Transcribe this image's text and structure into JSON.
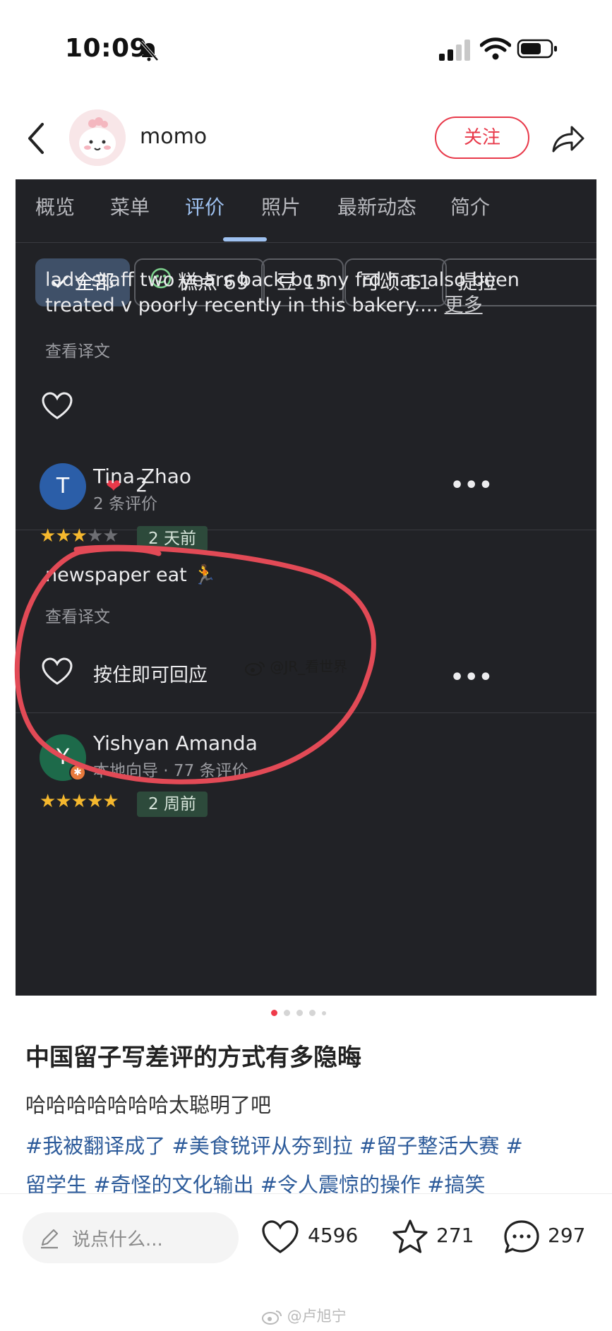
{
  "status_bar": {
    "time": "10:09"
  },
  "header": {
    "author": "momo",
    "follow_label": "关注"
  },
  "screenshot": {
    "tabs": [
      {
        "label": "概览"
      },
      {
        "label": "菜单"
      },
      {
        "label": "评价",
        "active": true
      },
      {
        "label": "照片"
      },
      {
        "label": "最新动态"
      },
      {
        "label": "简介"
      }
    ],
    "filters": [
      {
        "label": "全部",
        "selected": true
      },
      {
        "label": "糕点 69"
      },
      {
        "label": "豆 15"
      },
      {
        "label": "可颂 11"
      },
      {
        "label": "提拉"
      }
    ],
    "review1": {
      "line1": "lady staff two years back bc my frd has also been",
      "line2": "treated v poorly recently in this bakery....",
      "more": "更多",
      "translate": "查看译文",
      "reaction_count": "2"
    },
    "review2": {
      "initial": "T",
      "name": "Tina Zhao",
      "meta": "2 条评价",
      "rating": 3,
      "date": "2 天前",
      "text": "newspaper eat",
      "translate": "查看译文",
      "reply_hint": "按住即可回应"
    },
    "review3": {
      "initial": "Y",
      "name": "Yishyan Amanda",
      "meta": "本地向导 · 77 条评价",
      "rating": 5,
      "date": "2 周前"
    },
    "watermark": "@JR_看世界"
  },
  "post": {
    "title": "中国留子写差评的方式有多隐晦",
    "body": "哈哈哈哈哈哈哈太聪明了吧",
    "tags_line1": "#我被翻译成了 #美食锐评从夯到拉 #留子整活大赛 #",
    "tags_line2": "留学生 #奇怪的文化输出 #令人震惊的操作 #搞笑"
  },
  "bottom_bar": {
    "placeholder": "说点什么...",
    "likes": "4596",
    "collects": "271",
    "comments": "297"
  },
  "footer_watermark": "@卢旭宁",
  "colors": {
    "accent": "#e8394a",
    "tag": "#2d5b9a",
    "dark_bg": "#212226",
    "tab_active": "#9ec1f0"
  }
}
